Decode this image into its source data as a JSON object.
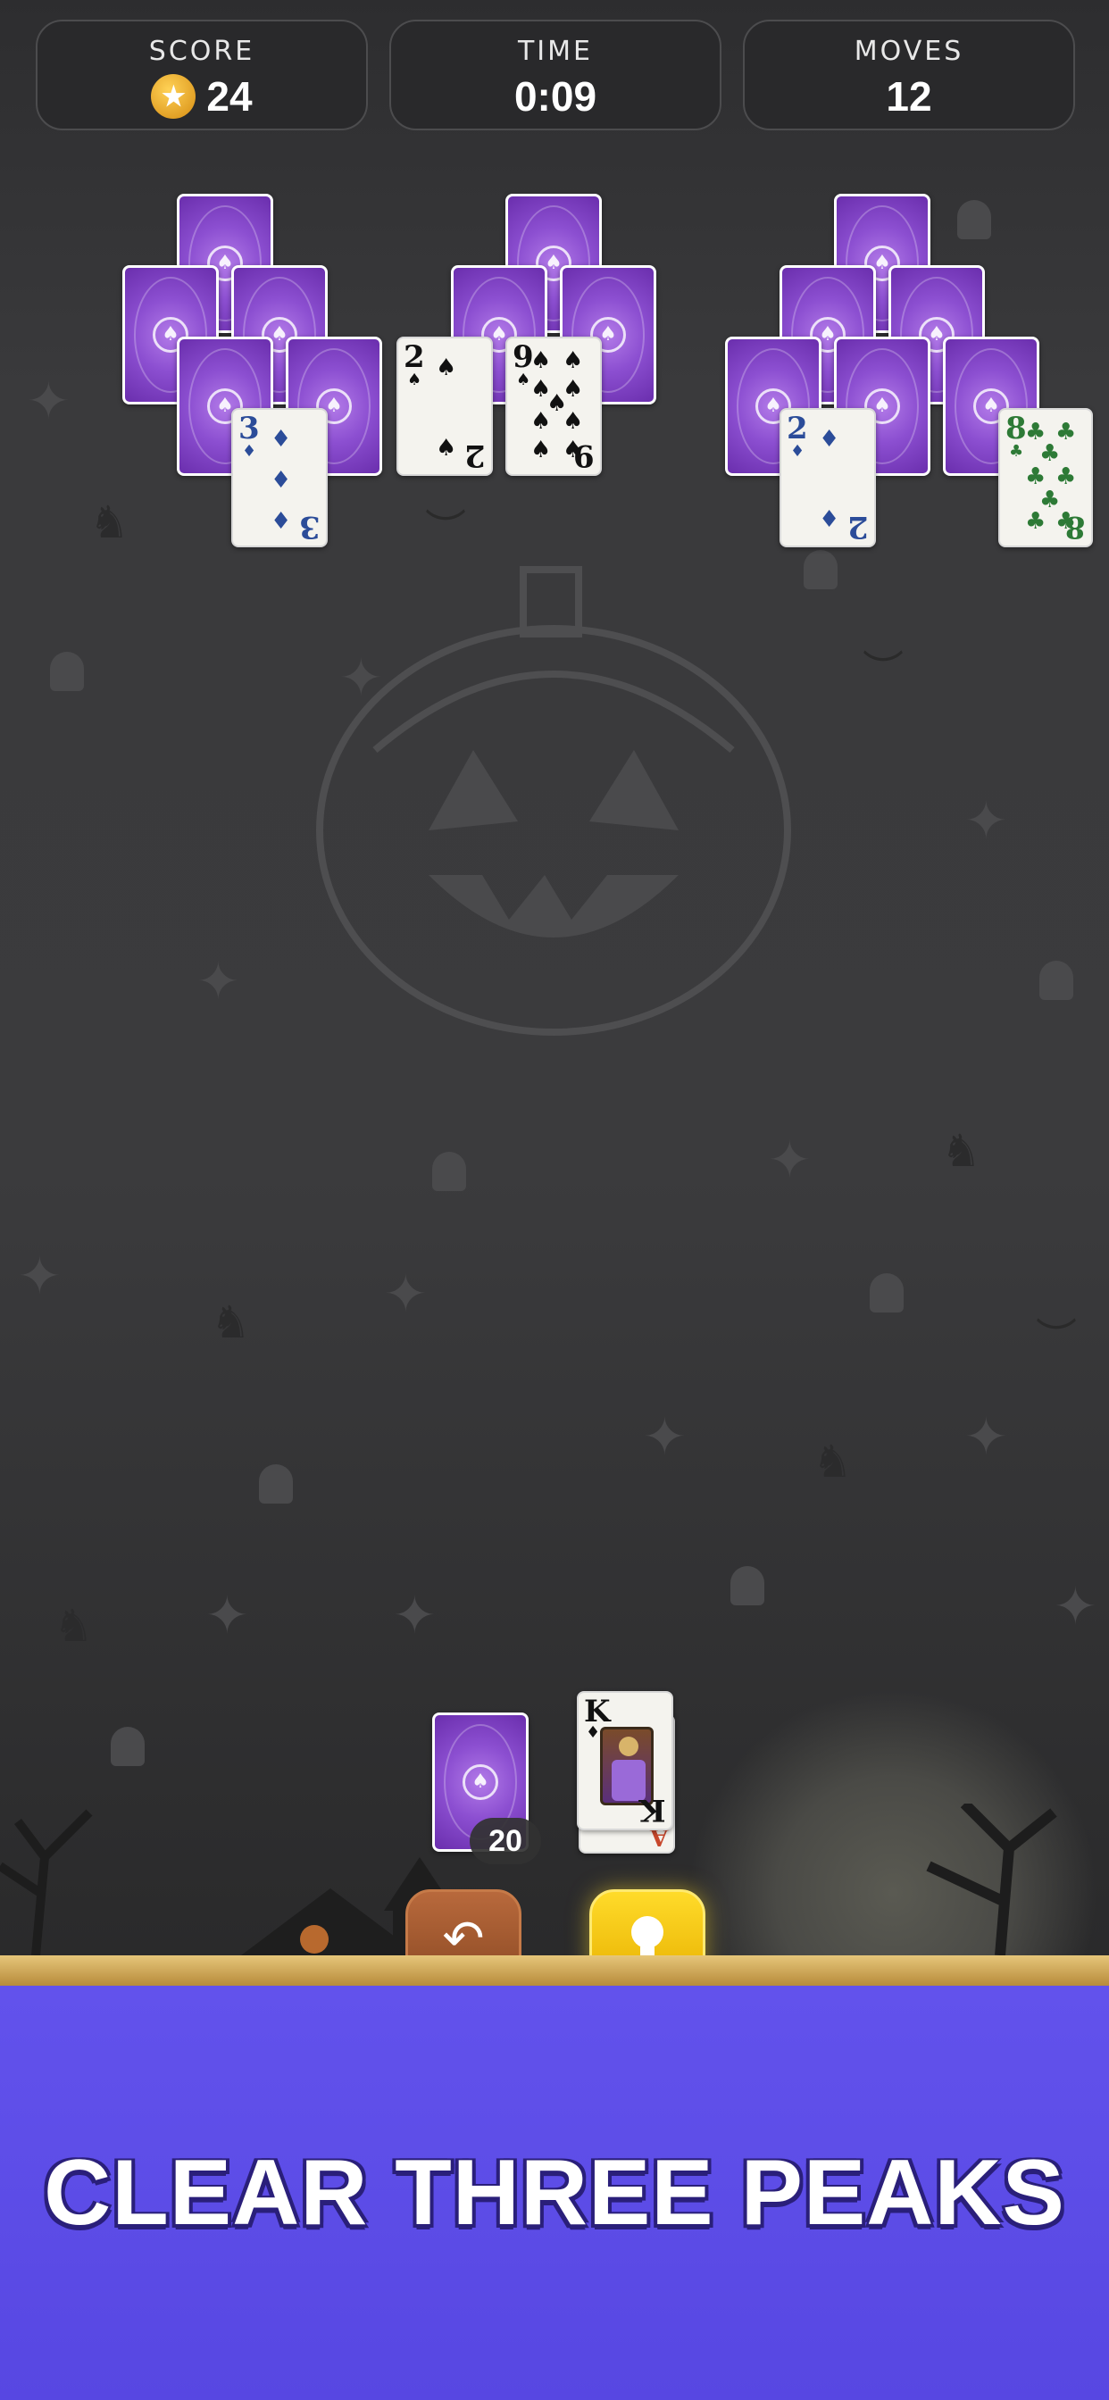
{
  "hud": {
    "score_label": "SCORE",
    "score_value": "24",
    "time_label": "TIME",
    "time_value": "0:09",
    "moves_label": "MOVES",
    "moves_value": "12"
  },
  "tableau": {
    "peak_1_face_up": [
      {
        "rank": "3",
        "suit": "diamonds"
      }
    ],
    "peak_2_face_up": [
      {
        "rank": "2",
        "suit": "spades"
      },
      {
        "rank": "9",
        "suit": "spades"
      }
    ],
    "peak_3_face_up": [
      {
        "rank": "2",
        "suit": "diamonds"
      },
      {
        "rank": "8",
        "suit": "clubs"
      }
    ]
  },
  "stock": {
    "remaining": "20"
  },
  "waste": {
    "top_rank": "K",
    "top_suit": "diamonds",
    "under_rank": "A"
  },
  "controls": {
    "undo_icon": "undo-arrow-icon",
    "hint_icon": "lightbulb-icon"
  },
  "banner": {
    "text": "CLEAR THREE PEAKS"
  },
  "colors": {
    "banner_bg": "#5747e2",
    "card_back": "#8c4fd1",
    "hint_button": "#f5c400",
    "undo_button": "#a45a30"
  }
}
